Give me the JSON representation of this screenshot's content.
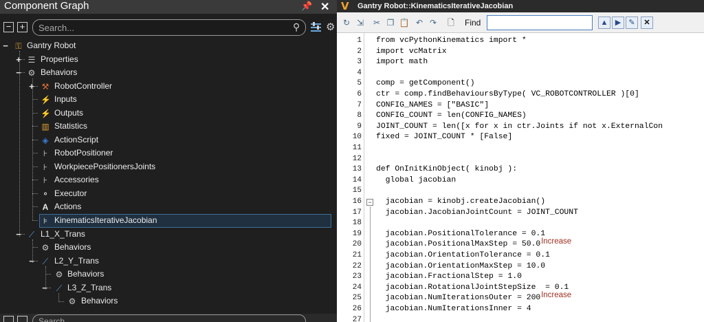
{
  "left_panel": {
    "title": "Component Graph",
    "search_placeholder": "Search...",
    "tree": [
      {
        "label": "Gantry Robot",
        "icon": "robot-icon",
        "color": "#e0a030"
      },
      {
        "label": "Properties",
        "icon": "properties-icon",
        "color": "#c8c8c8"
      },
      {
        "label": "Behaviors",
        "icon": "gear-icon",
        "color": "#c8c8c8"
      },
      {
        "label": "RobotController",
        "icon": "robot-controller-icon",
        "color": "#e07030"
      },
      {
        "label": "Inputs",
        "icon": "signal-icon",
        "color": "#e0c030"
      },
      {
        "label": "Outputs",
        "icon": "signal-icon",
        "color": "#e0c030"
      },
      {
        "label": "Statistics",
        "icon": "statistics-icon",
        "color": "#e0a030"
      },
      {
        "label": "ActionScript",
        "icon": "python-icon",
        "color": "#3a7bd5"
      },
      {
        "label": "RobotPositioner",
        "icon": "joint-icon",
        "color": "#c8c8c8"
      },
      {
        "label": "WorkpiecePositionersJoints",
        "icon": "joint-icon",
        "color": "#c8c8c8"
      },
      {
        "label": "Accessories",
        "icon": "joint-icon",
        "color": "#c8c8c8"
      },
      {
        "label": "Executor",
        "icon": "executor-icon",
        "color": "#e8e8e8"
      },
      {
        "label": "Actions",
        "icon": "actions-icon",
        "color": "#e8e8e8"
      },
      {
        "label": "KinematicsIterativeJacobian",
        "icon": "kinematics-icon",
        "color": "#c8c8c8"
      },
      {
        "label": "L1_X_Trans",
        "icon": "link-icon",
        "color": "#5aa0e0"
      },
      {
        "label": "Behaviors",
        "icon": "gear-icon",
        "color": "#c8c8c8"
      },
      {
        "label": "L2_Y_Trans",
        "icon": "link-icon",
        "color": "#5aa0e0"
      },
      {
        "label": "Behaviors",
        "icon": "gear-icon",
        "color": "#c8c8c8"
      },
      {
        "label": "L3_Z_Trans",
        "icon": "link-icon",
        "color": "#5aa0e0"
      },
      {
        "label": "Behaviors",
        "icon": "gear-icon",
        "color": "#c8c8c8"
      }
    ],
    "bottom_search_placeholder": "Search..."
  },
  "editor": {
    "title": "Gantry Robot::KinematicsIterativeJacobian",
    "find_label": "Find",
    "find_value": "",
    "lines": [
      "from vcPythonKinematics import *",
      "import vcMatrix",
      "import math",
      "",
      "comp = getComponent()",
      "ctr = comp.findBehavioursByType( VC_ROBOTCONTROLLER )[0]",
      "CONFIG_NAMES = [\"BASIC\"]",
      "CONFIG_COUNT = len(CONFIG_NAMES)",
      "JOINT_COUNT = len([x for x in ctr.Joints if not x.ExternalCon",
      "fixed = JOINT_COUNT * [False]",
      "",
      "",
      "def OnInitKinObject( kinobj ):",
      "  global jacobian",
      "",
      "  jacobian = kinobj.createJacobian()",
      "  jacobian.JacobianJointCount = JOINT_COUNT",
      "",
      "  jacobian.PositionalTolerance = 0.1",
      "  jacobian.PositionalMaxStep = 50.0",
      "  jacobian.OrientationTolerance = 0.1",
      "  jacobian.OrientationMaxStep = 10.0",
      "  jacobian.FractionalStep = 1.0",
      "  jacobian.RotationalJointStepSize  = 0.1",
      "  jacobian.NumIterationsOuter = 200",
      "  jacobian.NumIterationsInner = 4",
      ""
    ],
    "line_numbers": [
      "1",
      "2",
      "3",
      "4",
      "5",
      "6",
      "7",
      "8",
      "9",
      "10",
      "11",
      "12",
      "13",
      "14",
      "15",
      "16",
      "17",
      "18",
      "19",
      "20",
      "21",
      "22",
      "23",
      "24",
      "25",
      "26",
      "27"
    ],
    "annotations": [
      {
        "line": 20,
        "text": "Increase"
      },
      {
        "line": 25,
        "text": "Increase"
      }
    ]
  }
}
